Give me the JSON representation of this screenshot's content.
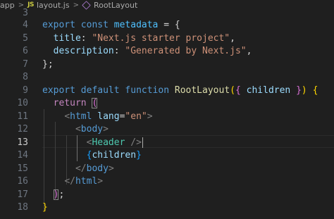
{
  "breadcrumb": {
    "folder": "app",
    "file": "layout.js",
    "file_icon_text": "JS",
    "symbol": "RootLayout",
    "separator": ">"
  },
  "active_line": 13,
  "line_numbers": [
    "3",
    "4",
    "5",
    "6",
    "7",
    "8",
    "9",
    "10",
    "11",
    "12",
    "13",
    "14",
    "15",
    "16",
    "17",
    "18"
  ],
  "code": {
    "export": "export",
    "const": "const",
    "metadata": "metadata",
    "eq_brace": " = {",
    "title_key": "title",
    "title_val": "\"Next.js starter project\"",
    "desc_key": "description",
    "desc_val": "\"Generated by Next.js\"",
    "close_obj": "};",
    "default": "default",
    "function": "function",
    "fn_name": "RootLayout",
    "children": "children",
    "return": "return",
    "html": "html",
    "lang": "lang",
    "lang_val": "\"en\"",
    "body": "body",
    "header": "Header",
    "close_brace": "}"
  }
}
